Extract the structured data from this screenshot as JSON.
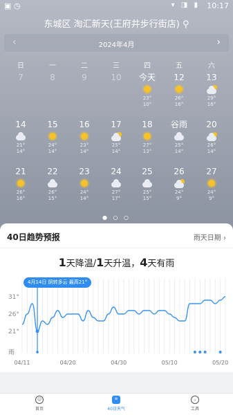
{
  "status_bar": {
    "time": "10:17",
    "left_icons": "▣ ◷",
    "right_icons": "▾ ◨ ▮"
  },
  "location": "东城区 淘汇新天(王府井步行街店)",
  "calendar": {
    "month_label": "2024年4月",
    "weekdays": [
      "日",
      "一",
      "二",
      "三",
      "四",
      "五",
      "六"
    ],
    "rows": [
      [
        {
          "day": "7",
          "past": true
        },
        {
          "day": "8",
          "past": true
        },
        {
          "day": "9",
          "past": true
        },
        {
          "day": "10",
          "past": true
        },
        {
          "day": "今天",
          "icon": "sun-icon",
          "hi": "23°",
          "lo": "10°"
        },
        {
          "day": "12",
          "icon": "sun-icon",
          "hi": "26°",
          "lo": "16°"
        },
        {
          "day": "13",
          "icon": "partly-cloudy-icon",
          "hi": "29°",
          "lo": "16°"
        }
      ],
      [
        {
          "day": "14",
          "icon": "cloud-icon",
          "hi": "21°",
          "lo": "14°"
        },
        {
          "day": "15",
          "icon": "sun-icon",
          "hi": "24°",
          "lo": "14°"
        },
        {
          "day": "16",
          "icon": "sun-icon",
          "hi": "23°",
          "lo": "14°"
        },
        {
          "day": "17",
          "icon": "partly-cloudy-icon",
          "hi": "25°",
          "lo": "14°"
        },
        {
          "day": "18",
          "icon": "sun-icon",
          "hi": "27°",
          "lo": "13°"
        },
        {
          "day": "谷雨",
          "icon": "cloud-icon",
          "hi": "25°",
          "lo": "14°"
        },
        {
          "day": "20",
          "icon": "partly-cloudy-icon",
          "hi": "26°",
          "lo": "14°"
        }
      ],
      [
        {
          "day": "21",
          "icon": "sun-icon",
          "hi": "26°",
          "lo": "16°"
        },
        {
          "day": "22",
          "icon": "cloud-icon",
          "hi": "26°",
          "lo": "15°"
        },
        {
          "day": "23",
          "icon": "sun-icon",
          "hi": "24°",
          "lo": "14°"
        },
        {
          "day": "24",
          "icon": "cloud-icon",
          "hi": "27°",
          "lo": "17°"
        },
        {
          "day": "25",
          "icon": "cloud-icon",
          "hi": "25°",
          "lo": "15°"
        },
        {
          "day": "26",
          "icon": "partly-cloudy-icon",
          "hi": "24°",
          "lo": "9°"
        },
        {
          "day": "27",
          "icon": "sun-icon",
          "hi": "24°",
          "lo": "9°"
        }
      ]
    ]
  },
  "trend": {
    "title": "40日趋势预报",
    "link": "雨天日期 ›",
    "summary": [
      {
        "num": "1",
        "text": "天降温/"
      },
      {
        "num": "1",
        "text": "天升温，"
      },
      {
        "num": "4",
        "text": "天有雨"
      }
    ],
    "tooltip": "4月14日 阴转多云 最高21°",
    "y_labels": [
      "31°",
      "26°",
      "21°",
      "雨"
    ],
    "x_labels": [
      "04/11",
      "04/20",
      "04/30",
      "05/10",
      "05/20"
    ],
    "rain_days": [
      34,
      35,
      36,
      39
    ],
    "selected_day": 3
  },
  "chart_data": {
    "type": "line",
    "x": [
      "04/11",
      "04/12",
      "04/13",
      "04/14",
      "04/15",
      "04/16",
      "04/17",
      "04/18",
      "04/19",
      "04/20",
      "04/21",
      "04/22",
      "04/23",
      "04/24",
      "04/25",
      "04/26",
      "04/27",
      "04/28",
      "04/29",
      "04/30",
      "05/01",
      "05/02",
      "05/03",
      "05/04",
      "05/05",
      "05/06",
      "05/07",
      "05/08",
      "05/09",
      "05/10",
      "05/11",
      "05/12",
      "05/13",
      "05/14",
      "05/15",
      "05/16",
      "05/17",
      "05/18",
      "05/19",
      "05/20",
      "05/21"
    ],
    "series": [
      {
        "values": [
          23,
          26,
          29,
          21,
          24,
          23,
          25,
          27,
          25,
          26,
          26,
          26,
          24,
          27,
          25,
          24,
          24,
          26,
          28,
          26,
          26,
          27,
          27,
          26,
          27,
          27,
          26,
          27,
          27,
          26,
          25,
          24,
          24,
          29,
          29,
          29,
          30,
          30,
          29,
          30,
          31
        ]
      }
    ],
    "ylim": [
      21,
      31
    ]
  },
  "tabbar": {
    "tabs": [
      {
        "label": "首页",
        "active": false
      },
      {
        "label": "40日天气",
        "active": true
      },
      {
        "label": "工具",
        "active": false
      }
    ]
  },
  "colors": {
    "accent": "#2f8cf0",
    "sun": "#f5c22a"
  }
}
